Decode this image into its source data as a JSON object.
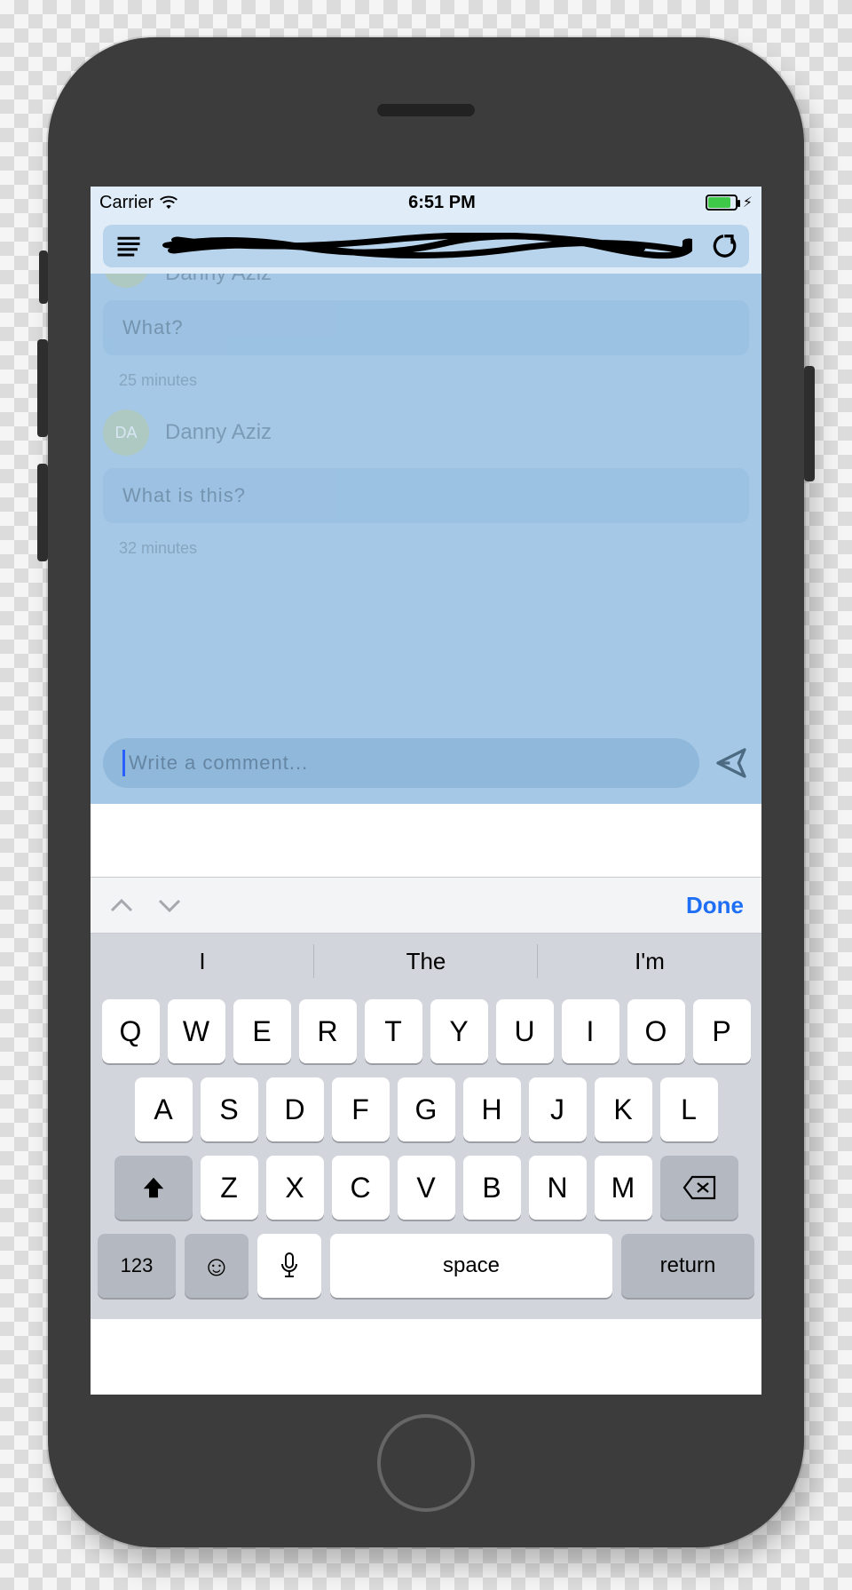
{
  "status": {
    "carrier": "Carrier",
    "time": "6:51 PM"
  },
  "chat": {
    "messages": [
      {
        "initials": "DA",
        "sender": "Danny Aziz",
        "text": "What?",
        "time": "25 minutes"
      },
      {
        "initials": "DA",
        "sender": "Danny Aziz",
        "text": "What is this?",
        "time": "32 minutes"
      }
    ],
    "compose_placeholder": "Write a comment..."
  },
  "accessory": {
    "done": "Done"
  },
  "suggestions": [
    "I",
    "The",
    "I'm"
  ],
  "keyboard": {
    "row1": [
      "Q",
      "W",
      "E",
      "R",
      "T",
      "Y",
      "U",
      "I",
      "O",
      "P"
    ],
    "row2": [
      "A",
      "S",
      "D",
      "F",
      "G",
      "H",
      "J",
      "K",
      "L"
    ],
    "row3": [
      "Z",
      "X",
      "C",
      "V",
      "B",
      "N",
      "M"
    ],
    "numkey": "123",
    "space": "space",
    "return": "return"
  }
}
